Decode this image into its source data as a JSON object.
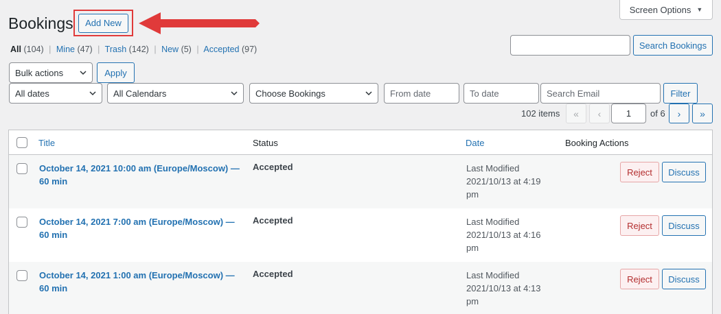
{
  "header": {
    "title": "Bookings",
    "add_new": "Add New",
    "screen_options": "Screen Options"
  },
  "filters_views": [
    {
      "label": "All",
      "count": "(104)",
      "current": true
    },
    {
      "label": "Mine",
      "count": "(47)"
    },
    {
      "label": "Trash",
      "count": "(142)"
    },
    {
      "label": "New",
      "count": "(5)"
    },
    {
      "label": "Accepted",
      "count": "(97)"
    }
  ],
  "search": {
    "value": "",
    "button": "Search Bookings"
  },
  "bulk": {
    "selected": "Bulk actions",
    "apply": "Apply"
  },
  "filters": {
    "dates": "All dates",
    "calendars": "All Calendars",
    "bookings": "Choose Bookings",
    "from_placeholder": "From date",
    "to_placeholder": "To date",
    "email_placeholder": "Search Email",
    "filter_button": "Filter"
  },
  "pagination": {
    "items": "102 items",
    "first": "«",
    "prev": "‹",
    "current": "1",
    "of": "of 6",
    "next": "›",
    "last": "»"
  },
  "table": {
    "columns": {
      "title": "Title",
      "status": "Status",
      "date": "Date",
      "actions": "Booking Actions"
    },
    "rows": [
      {
        "title": "October 14, 2021 10:00 am (Europe/Moscow) — 60 min",
        "status": "Accepted",
        "date_label": "Last Modified",
        "date_value": "2021/10/13 at 4:19 pm",
        "reject": "Reject",
        "discuss": "Discuss"
      },
      {
        "title": "October 14, 2021 7:00 am (Europe/Moscow) — 60 min",
        "status": "Accepted",
        "date_label": "Last Modified",
        "date_value": "2021/10/13 at 4:16 pm",
        "reject": "Reject",
        "discuss": "Discuss"
      },
      {
        "title": "October 14, 2021 1:00 am (Europe/Moscow) — 60 min",
        "status": "Accepted",
        "date_label": "Last Modified",
        "date_value": "2021/10/13 at 4:13 pm",
        "reject": "Reject",
        "discuss": "Discuss"
      }
    ]
  },
  "colors": {
    "accent": "#2271b1",
    "highlight": "#e03a3a",
    "reject": "#b32d2e"
  }
}
